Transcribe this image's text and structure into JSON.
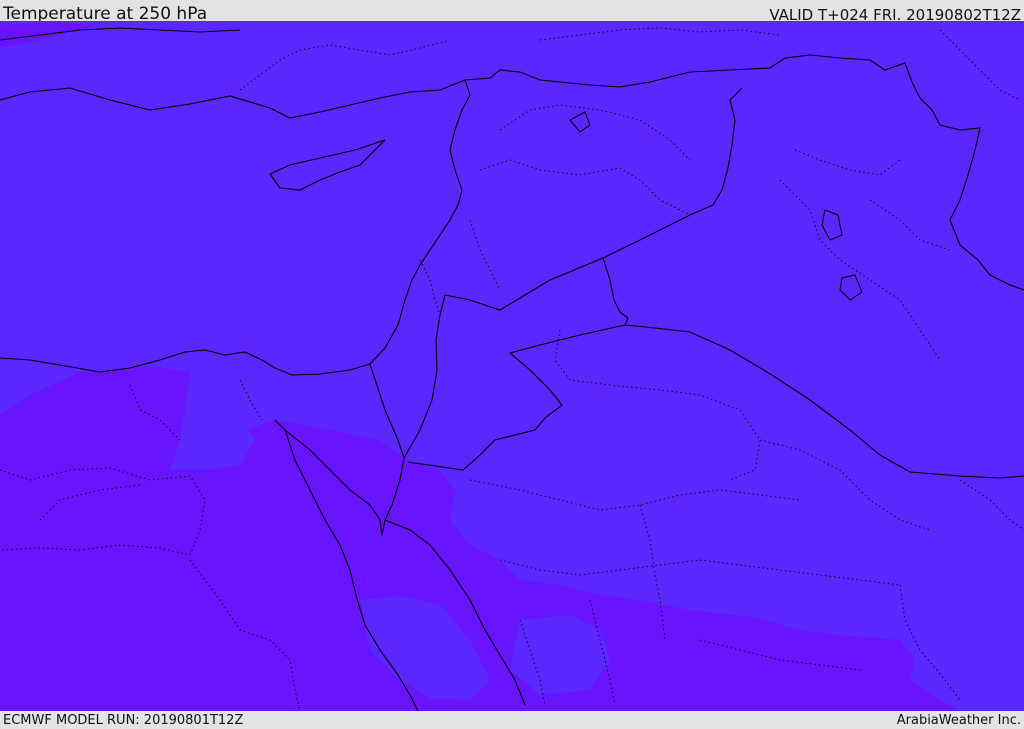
{
  "header": {
    "title": "Temperature at 250 hPa",
    "valid": "VALID T+024 FRI. 20190802T12Z"
  },
  "footer": {
    "model_run": "ECMWF MODEL RUN: 20190801T12Z",
    "credit": "ArabiaWeather Inc."
  },
  "colors": {
    "field_main": "#5a28fe",
    "field_warm": "#6814fe",
    "coast_border": "#000000",
    "bar_background": "#e3e3e3"
  }
}
